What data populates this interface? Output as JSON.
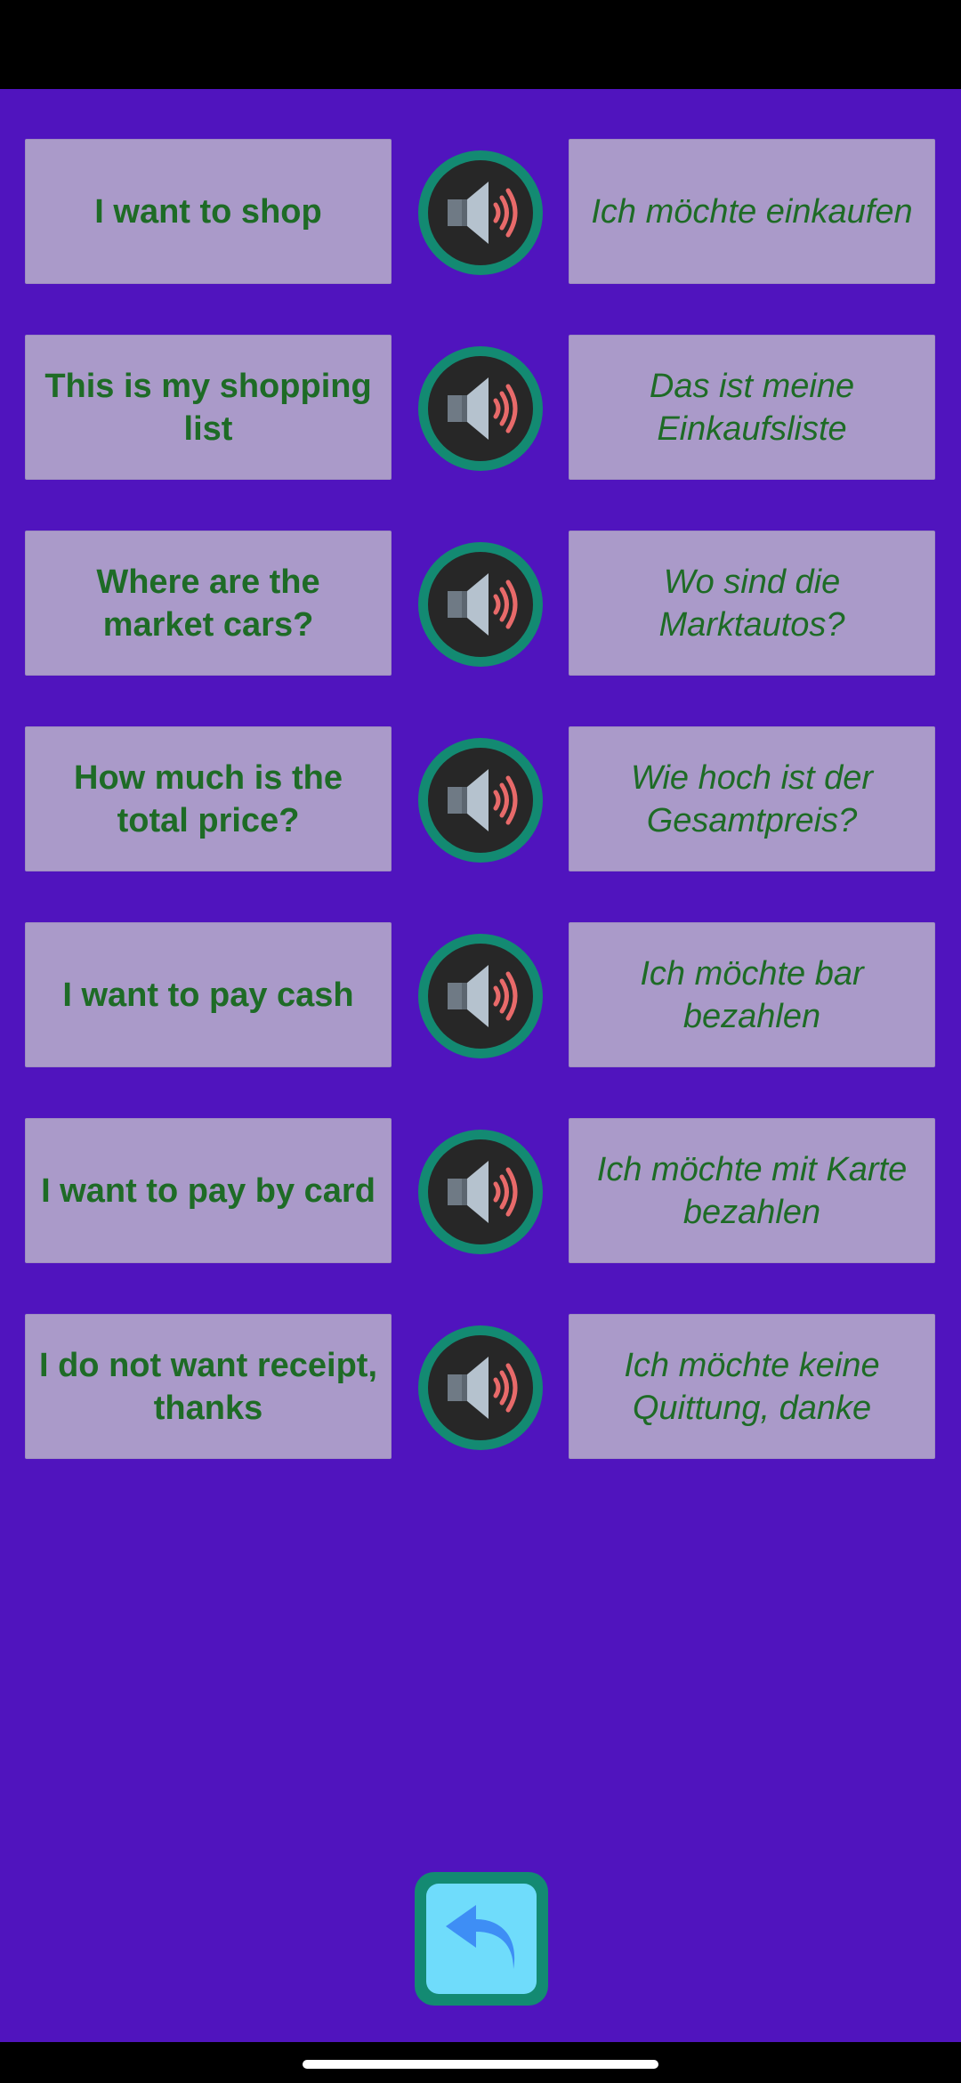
{
  "colors": {
    "background": "#5014be",
    "card": "#aa9ac9",
    "text": "#1e6b26",
    "speaker_ring": "#138a72",
    "speaker_inner": "#272727",
    "back_button_fill": "#6fdcfb",
    "back_arrow": "#3e8ef5"
  },
  "phrases": [
    {
      "en": "I want to shop",
      "de": "Ich möchte einkaufen",
      "icon": "speaker-icon"
    },
    {
      "en": "This is my shopping list",
      "de": "Das ist meine Einkaufsliste",
      "icon": "speaker-icon"
    },
    {
      "en": "Where are the market cars?",
      "de": "Wo sind die Marktautos?",
      "icon": "speaker-icon"
    },
    {
      "en": "How much is the total price?",
      "de": "Wie hoch ist der Gesamtpreis?",
      "icon": "speaker-icon"
    },
    {
      "en": "I want to pay cash",
      "de": "Ich möchte bar bezahlen",
      "icon": "speaker-icon"
    },
    {
      "en": "I want to pay by card",
      "de": "Ich möchte mit Karte bezahlen",
      "icon": "speaker-icon"
    },
    {
      "en": "I do not want receipt, thanks",
      "de": "Ich möchte keine Quittung, danke",
      "icon": "speaker-icon"
    }
  ],
  "back_button": {
    "icon": "back-arrow-icon"
  }
}
